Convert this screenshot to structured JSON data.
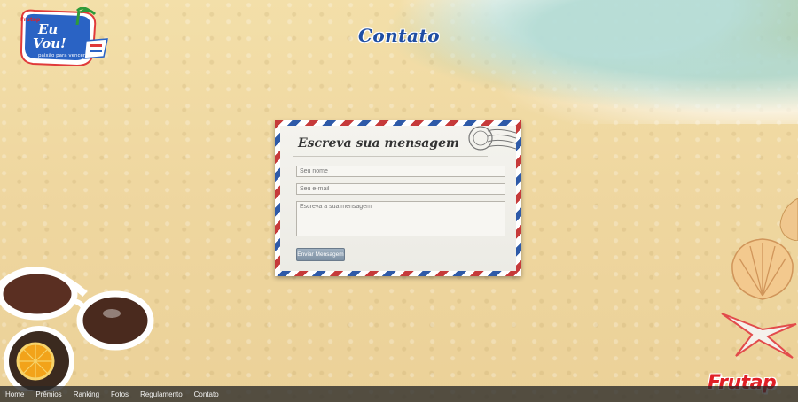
{
  "header": {
    "logo_text_line1": "Eu",
    "logo_text_line2": "Vou!",
    "logo_slogan": "paixão para vencer",
    "logo_brand_mini": "Frutap",
    "page_title": "Contato"
  },
  "form": {
    "heading": "Escreva sua mensagem",
    "name_placeholder": "Seu nome",
    "email_placeholder": "Seu e-mail",
    "message_placeholder": "Escreva a sua mensagem",
    "submit_label": "Enviar Mensagem"
  },
  "nav": {
    "items": [
      {
        "label": "Home"
      },
      {
        "label": "Prêmios"
      },
      {
        "label": "Ranking"
      },
      {
        "label": "Fotos"
      },
      {
        "label": "Regulamento"
      },
      {
        "label": "Contato"
      }
    ]
  },
  "footer": {
    "brand": "Frutap"
  },
  "colors": {
    "title_blue": "#1f4ea3",
    "brand_red": "#e01f26",
    "sand": "#efd7a0",
    "nav_bg": "#2a2a2a"
  }
}
